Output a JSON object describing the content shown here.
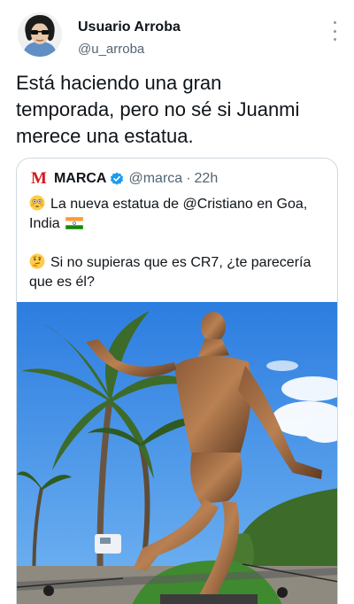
{
  "tweet": {
    "author_name": "Usuario Arroba",
    "author_handle": "@u_arroba",
    "text": "Está haciendo una gran\ntemporada, pero no sé si Juanmi\nmerece una estatua."
  },
  "quote": {
    "logo_text": "M",
    "name": "MARCA",
    "handle": "@marca",
    "separator": "·",
    "time": "22h",
    "line1": "La nueva estatua de @Cristiano en Goa,",
    "line2": "India",
    "line3": "Si no supieras que es CR7, ¿te parecería",
    "line4": "que es él?",
    "icons": [
      "flushed-face-icon",
      "india-flag-icon",
      "thinking-face-icon",
      "verified-badge-icon"
    ]
  },
  "colors": {
    "text": "#0f1419",
    "secondary": "#536471",
    "border": "#cfd9de",
    "marca_red": "#d9141b",
    "verified_blue": "#1d9bf0",
    "sky": "#3f8ee6"
  }
}
